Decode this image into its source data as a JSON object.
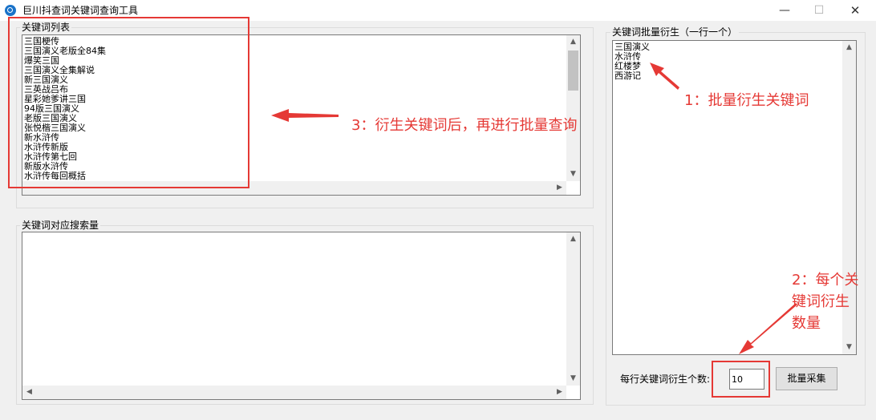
{
  "window": {
    "title": "巨川抖查词关键词查询工具",
    "min_glyph": "—",
    "max_glyph": "☐",
    "close_glyph": "✕"
  },
  "keyword_list": {
    "label": "关键词列表",
    "lines": "三国梗传\n三国演义老版全84集\n爆笑三国\n三国演义全集解说\n新三国演义\n三英战吕布\n星彩她爹讲三国\n94版三国演义\n老版三国演义\n张悦楷三国演义\n新水浒传\n水浒传新版\n水浒传第七回\n新版水浒传\n水浒传每回概括"
  },
  "search_volume": {
    "label": "关键词对应搜索量",
    "lines": ""
  },
  "batch_derive": {
    "label": "关键词批量衍生（一行一个）",
    "lines": "三国演义\n水浒传\n红楼梦\n西游记"
  },
  "controls": {
    "count_label": "每行关键词衍生个数:",
    "count_value": "10",
    "collect_button": "批量采集"
  },
  "scroll": {
    "up": "▲",
    "down": "▼",
    "left": "◀",
    "right": "▶"
  },
  "annotations": {
    "note1": "1：批量衍生关键词",
    "note2": "2：每个关\n键词衍生\n数量",
    "note3": "3：衍生关键词后，再进行批量查询",
    "color": "#e53935"
  }
}
